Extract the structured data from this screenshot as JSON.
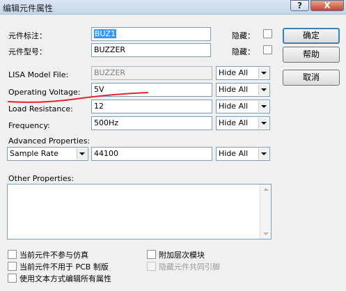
{
  "window": {
    "title": "编辑元件属性",
    "help_glyph": "?",
    "close_glyph": "X"
  },
  "fields": {
    "part_reference": {
      "label": "元件标注：",
      "value": "BUZ1",
      "hidden_label": "隐藏："
    },
    "part_value": {
      "label": "元件型号：",
      "value": "BUZZER",
      "hidden_label": "隐藏："
    },
    "lisa_model_file": {
      "label": "LISA Model File:",
      "value": "BUZZER",
      "visibility": "Hide All"
    },
    "operating_voltage": {
      "label": "Operating Voltage:",
      "value": "5V",
      "visibility": "Hide All"
    },
    "load_resistance": {
      "label": "Load Resistance:",
      "value": "12",
      "visibility": "Hide All"
    },
    "frequency": {
      "label": "Frequency:",
      "value": "500Hz",
      "visibility": "Hide All"
    }
  },
  "advanced": {
    "label": "Advanced Properties:",
    "property": "Sample Rate",
    "value": "44100",
    "visibility": "Hide All"
  },
  "other": {
    "label": "Other Properties:"
  },
  "buttons": {
    "ok": "确定",
    "help": "帮助",
    "cancel": "取消"
  },
  "options": {
    "exclude_simulation": "当前元件不参与仿真",
    "exclude_pcb": "当前元件不用于 PCB 制版",
    "edit_as_text": "使用文本方式编辑所有属性",
    "attach_hierarchy": "附加层次模块",
    "hide_common_pins": "隐藏元件共同引脚"
  },
  "colors": {
    "annotation": "#e8202a",
    "selection": "#3399ff"
  }
}
